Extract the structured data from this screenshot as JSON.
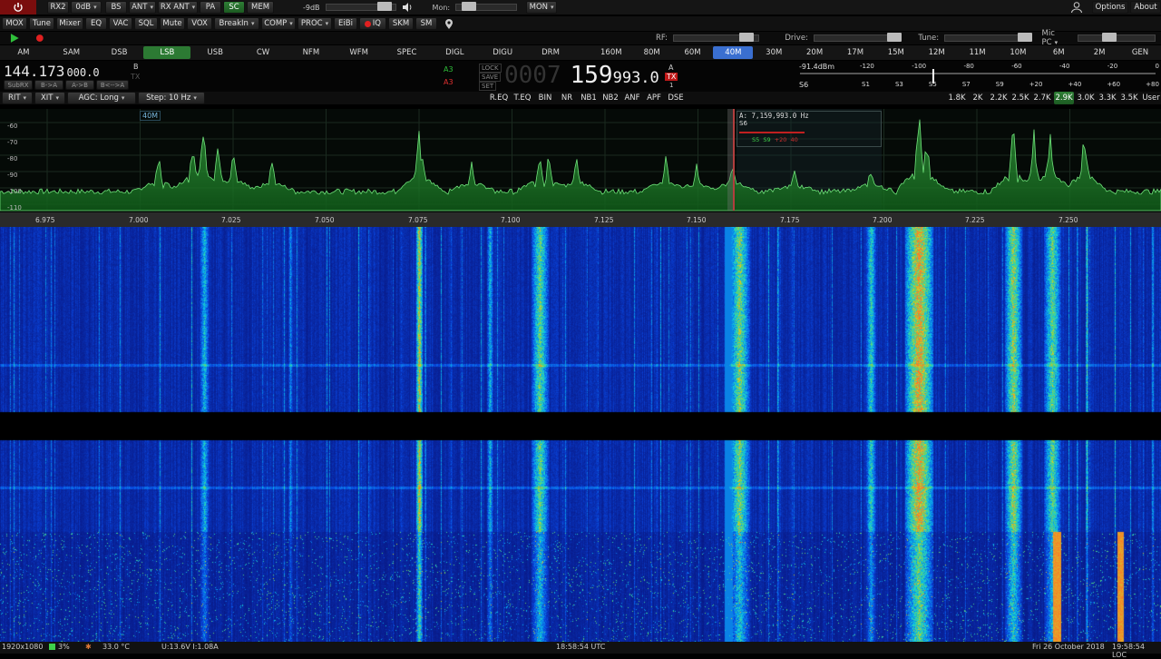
{
  "top_bar": {
    "buttons": [
      "RX2",
      "0dB",
      "BS",
      "ANT",
      "RX ANT",
      "PA",
      "SC",
      "MEM"
    ],
    "attenuation": "-9dB",
    "mon_label": "Mon:",
    "mon_select": "MON",
    "options": "Options",
    "about": "About"
  },
  "row2": {
    "buttons": [
      "MOX",
      "Tune",
      "Mixer",
      "EQ",
      "VAC",
      "SQL",
      "Mute",
      "VOX",
      "BreakIn",
      "COMP",
      "PROC",
      "EiBi",
      "IQ",
      "SKM",
      "SM"
    ]
  },
  "row3": {
    "rf_label": "RF:",
    "drive_label": "Drive:",
    "tune_label": "Tune:",
    "mic_label": "Mic PC"
  },
  "modes": [
    "AM",
    "SAM",
    "DSB",
    "LSB",
    "USB",
    "CW",
    "NFM",
    "WFM",
    "SPEC",
    "DIGL",
    "DIGU",
    "DRM"
  ],
  "active_mode": "LSB",
  "bands": [
    "160M",
    "80M",
    "60M",
    "40M",
    "30M",
    "20M",
    "17M",
    "15M",
    "12M",
    "11M",
    "10M",
    "6M",
    "2M",
    "GEN"
  ],
  "active_band": "40M",
  "vfo": {
    "b_freq": "144.173",
    "b_freq_sub": "000.0",
    "b_label": "B",
    "tx_label": "TX",
    "a_prefix": "0007",
    "a_freq": "159",
    "a_freq_sub": "993.0",
    "sub_rx": "SubRX",
    "b_to_a": "B->A",
    "a_to_b": "A->B",
    "swap": "B<-->A",
    "a3_top": "A3",
    "a3_bottom": "A3",
    "lock": "LOCK",
    "save": "SAVE",
    "set": "SET",
    "a_label": "A",
    "tx_red": "TX",
    "tx_num": "1"
  },
  "meter": {
    "dbm": "-91.4dBm",
    "s_reading": "S6",
    "top_scale": [
      "-120",
      "-100",
      "-80",
      "-60",
      "-40",
      "-20",
      "0"
    ],
    "bottom_scale": [
      "S1",
      "S3",
      "S5",
      "S7",
      "S9",
      "+20",
      "+40",
      "+60",
      "+80"
    ]
  },
  "row5": {
    "rit": "RIT",
    "xit": "XIT",
    "agc": "AGC: Long",
    "step": "Step: 10 Hz",
    "dsp": [
      "R.EQ",
      "T.EQ",
      "BIN",
      "NR",
      "NB1",
      "NB2",
      "ANF",
      "APF",
      "DSE"
    ],
    "filters": [
      "1.8K",
      "2K",
      "2.2K",
      "2.5K",
      "2.7K",
      "2.9K",
      "3.0K",
      "3.3K",
      "3.5K",
      "User"
    ],
    "active_filter": "2.9K"
  },
  "panadapter": {
    "band_label": "40M",
    "db_labels": [
      "-60",
      "-70",
      "-80",
      "-90",
      "-100",
      "-110"
    ],
    "freq_labels": [
      "6.975",
      "7.000",
      "7.025",
      "7.050",
      "7.075",
      "7.100",
      "7.125",
      "7.150",
      "7.175",
      "7.200",
      "7.225",
      "7.250"
    ],
    "cursor_info": "A: 7,159,993.0 Hz",
    "cursor_s": "S6",
    "mini_meter": [
      "S5",
      "S9",
      "+20",
      "40"
    ]
  },
  "status": {
    "resolution": "1920x1080",
    "cpu": "3%",
    "temp": "33.0 °C",
    "power": "U:13.6V I:1.08A",
    "utc": "18:58:54 UTC",
    "date": "Fri 26 October 2018",
    "local": "19:58:54 LOC"
  },
  "colors": {
    "active_green": "#2c7a33",
    "active_blue": "#3a6fd0",
    "spectrum": "#4fd25a",
    "tx_marker": "#d02020"
  }
}
